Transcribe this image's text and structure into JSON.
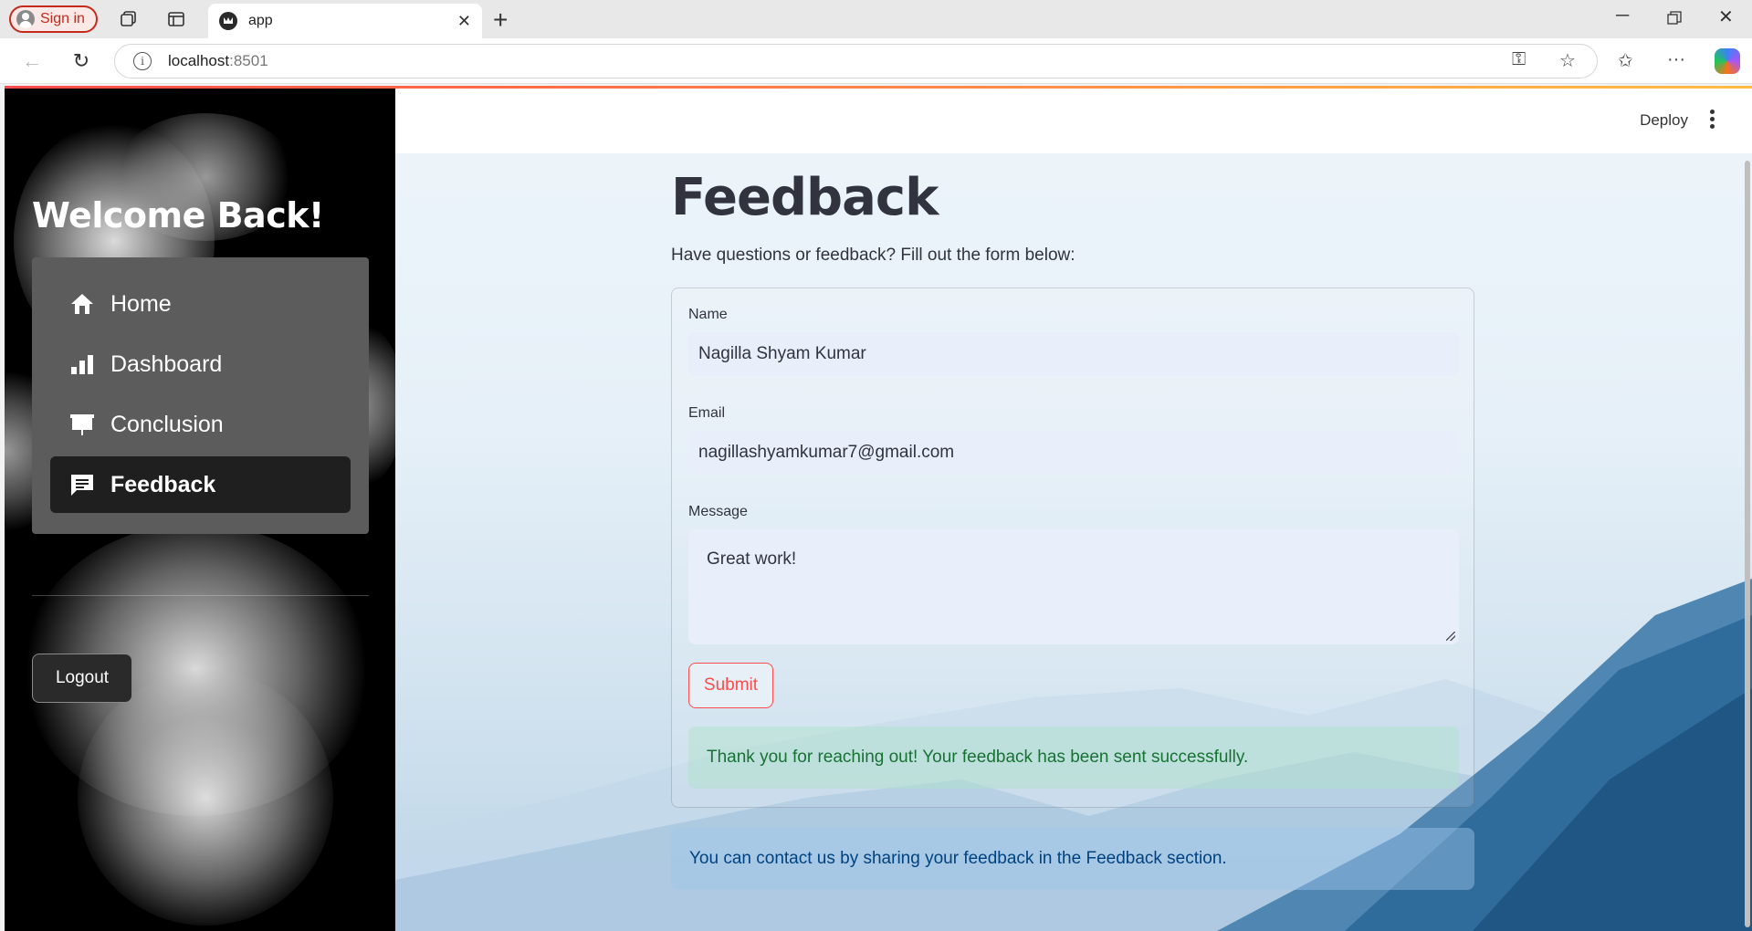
{
  "browser": {
    "signin_label": "Sign in",
    "tab_title": "app",
    "url_host": "localhost",
    "url_port": ":8501"
  },
  "app": {
    "header": {
      "deploy_label": "Deploy"
    },
    "sidebar": {
      "welcome": "Welcome Back!",
      "menu": [
        {
          "label": "Home",
          "icon": "home-icon"
        },
        {
          "label": "Dashboard",
          "icon": "bar-chart-icon"
        },
        {
          "label": "Conclusion",
          "icon": "presentation-icon"
        },
        {
          "label": "Feedback",
          "icon": "chat-icon",
          "active": true
        }
      ],
      "logout_label": "Logout"
    },
    "main": {
      "title": "Feedback",
      "subtitle": "Have questions or feedback? Fill out the form below:",
      "form": {
        "name_label": "Name",
        "name_value": "Nagilla Shyam Kumar",
        "email_label": "Email",
        "email_value": "nagillashyamkumar7@gmail.com",
        "message_label": "Message",
        "message_value": "Great work!",
        "submit_label": "Submit",
        "success_message": "Thank you for reaching out! Your feedback has been sent successfully."
      },
      "info_message": "You can contact us by sharing your feedback in the Feedback section."
    },
    "colors": {
      "primary": "#ff4b4b",
      "success_text": "#177233",
      "info_text": "#004280",
      "sidebar_bg": "#000000",
      "menu_bg": "#5c5c5c",
      "menu_active_bg": "#1f1f1f"
    }
  }
}
